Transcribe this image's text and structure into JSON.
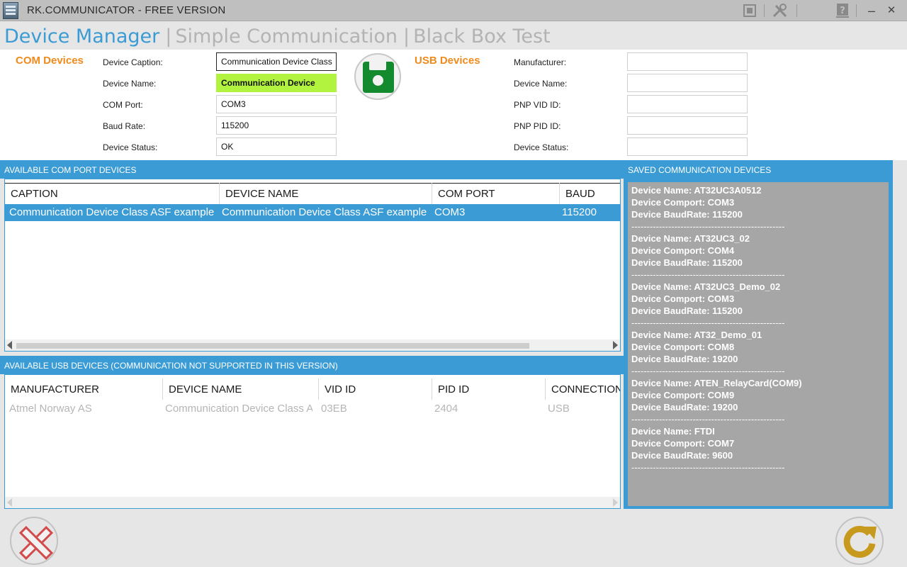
{
  "window": {
    "title": "RK.COMMUNICATOR - FREE VERSION",
    "icons": [
      "app-icon",
      "hardware-chip-icon",
      "tools-icon",
      "help-icon",
      "minimize-icon",
      "close-icon"
    ],
    "minimize_glyph": "–",
    "close_glyph": "✕"
  },
  "nav": {
    "tabs": [
      {
        "label": "Device Manager",
        "active": true
      },
      {
        "label": "Simple Communication",
        "active": false
      },
      {
        "label": "Black Box Test",
        "active": false
      }
    ],
    "separator": "|"
  },
  "com_form": {
    "title": "COM Devices",
    "fields": [
      {
        "label": "Device Caption:",
        "value": "Communication Device Class"
      },
      {
        "label": "Device Name:",
        "value": "Communication Device"
      },
      {
        "label": "COM Port:",
        "value": "COM3"
      },
      {
        "label": "Baud Rate:",
        "value": "115200"
      },
      {
        "label": "Device Status:",
        "value": "OK"
      }
    ]
  },
  "usb_form": {
    "title": "USB Devices",
    "fields": [
      {
        "label": "Manufacturer:",
        "value": ""
      },
      {
        "label": "Device Name:",
        "value": ""
      },
      {
        "label": "PNP VID ID:",
        "value": ""
      },
      {
        "label": "PNP PID ID:",
        "value": ""
      },
      {
        "label": "Device Status:",
        "value": ""
      }
    ]
  },
  "com_grid": {
    "header": "AVAILABLE COM PORT DEVICES",
    "columns": [
      "CAPTION",
      "DEVICE NAME",
      "COM PORT",
      "BAUD"
    ],
    "rows": [
      [
        "Communication Device Class ASF example (",
        "Communication Device Class ASF example (",
        "COM3",
        "115200"
      ]
    ]
  },
  "usb_grid": {
    "header": "AVAILABLE USB DEVICES (COMMUNICATION NOT SUPPORTED IN THIS VERSION)",
    "columns": [
      "MANUFACTURER",
      "DEVICE NAME",
      "VID ID",
      "PID ID",
      "CONNECTION"
    ],
    "rows": [
      [
        "Atmel Norway AS",
        "Communication Device Class AS",
        "03EB",
        "2404",
        "USB"
      ]
    ]
  },
  "saved": {
    "header": "SAVED COMMUNICATION DEVICES",
    "separator": "--------------------------------------------------",
    "items": [
      {
        "name": "Device Name: AT32UC3A0512",
        "port": "Device Comport: COM3",
        "baud": "Device BaudRate: 115200"
      },
      {
        "name": "Device Name: AT32UC3_02",
        "port": "Device Comport: COM4",
        "baud": "Device BaudRate: 115200"
      },
      {
        "name": "Device Name: AT32UC3_Demo_02",
        "port": "Device Comport: COM3",
        "baud": "Device BaudRate: 115200"
      },
      {
        "name": "Device Name: AT32_Demo_01",
        "port": "Device Comport: COM8",
        "baud": "Device BaudRate: 19200"
      },
      {
        "name": "Device Name: ATEN_RelayCard(COM9)",
        "port": "Device Comport: COM9",
        "baud": "Device BaudRate: 19200"
      },
      {
        "name": "Device Name: FTDI",
        "port": "Device Comport: COM7",
        "baud": "Device BaudRate: 9600"
      }
    ]
  },
  "colors": {
    "accent": "#3a9bd5",
    "section_title": "#f08a1c",
    "highlight_field": "#b1f33e",
    "save_icon": "#148a2e",
    "cancel_icon": "#d24a4a",
    "refresh_icon": "#c79a1e"
  },
  "actions": {
    "save_icon": "floppy-disk-icon",
    "cancel_icon": "cancel-x-icon",
    "refresh_icon": "refresh-icon"
  }
}
